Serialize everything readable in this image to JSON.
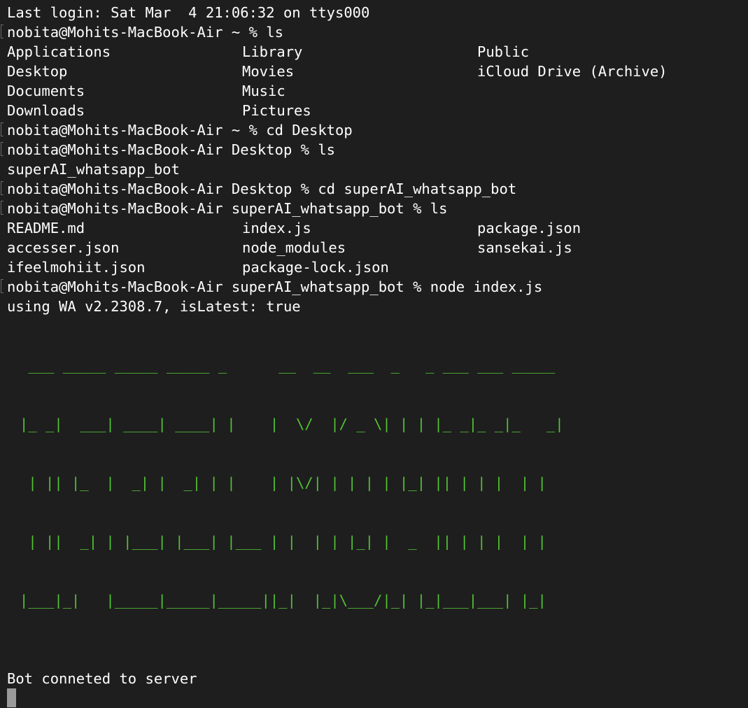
{
  "terminal": {
    "last_login": "Last login: Sat Mar  4 21:06:32 on ttys000",
    "commands": [
      "nobita@Mohits-MacBook-Air ~ % ls",
      "nobita@Mohits-MacBook-Air ~ % cd Desktop",
      "nobita@Mohits-MacBook-Air Desktop % ls",
      "nobita@Mohits-MacBook-Air Desktop % cd superAI_whatsapp_bot",
      "nobita@Mohits-MacBook-Air superAI_whatsapp_bot % ls",
      "nobita@Mohits-MacBook-Air superAI_whatsapp_bot % node index.js"
    ],
    "home_listing": [
      [
        "Applications",
        "Library",
        "Public"
      ],
      [
        "Desktop",
        "Movies",
        "iCloud Drive (Archive)"
      ],
      [
        "Documents",
        "Music",
        ""
      ],
      [
        "Downloads",
        "Pictures",
        ""
      ]
    ],
    "desktop_listing": "superAI_whatsapp_bot",
    "bot_listing": [
      [
        "README.md",
        "index.js",
        "package.json"
      ],
      [
        "accesser.json",
        "node_modules",
        "sansekai.js"
      ],
      [
        "ifeelmohiit.json",
        "package-lock.json",
        ""
      ]
    ],
    "wa_version": "using WA v2.2308.7, isLatest: true",
    "banner_lines": [
      " ___ _____ _____ _____ _      __  __  ___  _   _ ___ ___ _____",
      "|_ _|  ___| ____| ____| |    |  \\/  |/ _ \\| | | |_ _|_ _|_   _|",
      " | || |_  |  _| |  _| | |    | |\\/| | | | | |_| || | | |  | |",
      " | ||  _| | |___| |___| |___ | |  | | |_| |  _  || | | |  | |",
      "|___|_|   |_____|_____|_____||_|  |_|\\___/|_| |_|___|___| |_|"
    ],
    "status": "Bot conneted to server",
    "colors": {
      "background": "#1e1e1e",
      "text": "#ffffff",
      "banner": "#52c234",
      "cursor": "#9a9a9a"
    }
  }
}
